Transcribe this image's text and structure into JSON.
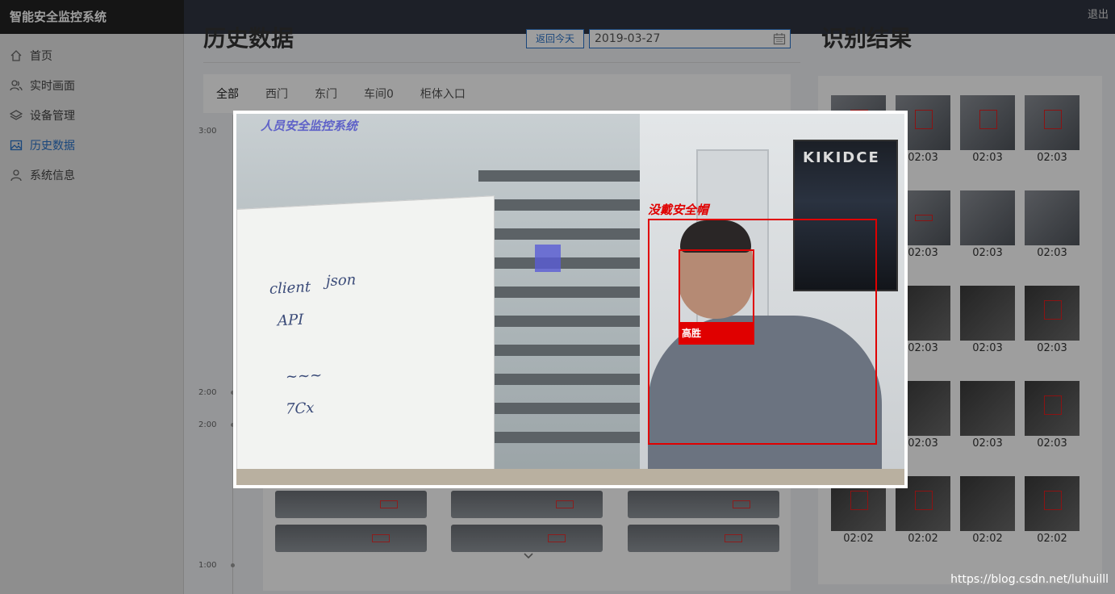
{
  "app": {
    "title": "智能安全监控系统",
    "logout": "退出"
  },
  "sidebar": {
    "items": [
      {
        "label": "首页",
        "icon": "home-icon"
      },
      {
        "label": "实时画面",
        "icon": "users-icon"
      },
      {
        "label": "设备管理",
        "icon": "layers-icon"
      },
      {
        "label": "历史数据",
        "icon": "image-icon"
      },
      {
        "label": "系统信息",
        "icon": "user-icon"
      }
    ],
    "active": "历史数据"
  },
  "history": {
    "title": "历史数据",
    "back_today": "返回今天",
    "date_value": "2019-03-27",
    "tabs": [
      "全部",
      "西门",
      "东门",
      "车间0",
      "柜体入口"
    ],
    "timeline_labels": [
      "3:00",
      "2:00",
      "2:00",
      "1:00"
    ]
  },
  "results": {
    "title": "识别结果",
    "times": [
      "02:03",
      "02:03",
      "02:03",
      "02:03",
      "02:03",
      "02:03",
      "02:03",
      "02:03",
      "02:03",
      "02:03",
      "02:03",
      "02:03",
      "02:02",
      "02:02",
      "02:02",
      "02:02"
    ]
  },
  "modal": {
    "camera_title": "人员安全监控系统",
    "alert_label": "没戴安全帽",
    "person_name": "高胜",
    "poster_text": "KIKIDCE"
  },
  "watermark": "https://blog.csdn.net/luhuilll",
  "colors": {
    "accent": "#2b73c8",
    "alert": "#e00000",
    "topbar": "#2f3542"
  }
}
